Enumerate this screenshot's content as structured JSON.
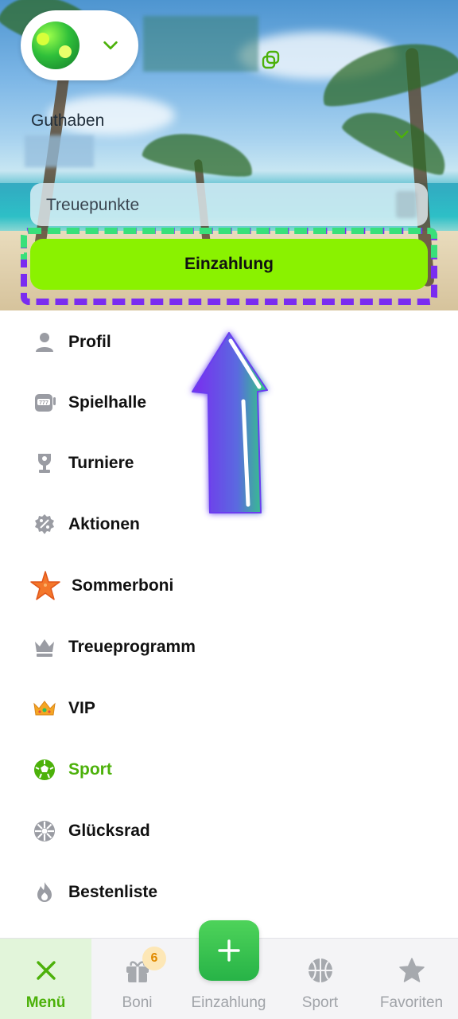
{
  "header": {
    "balance_label": "Guthaben",
    "loyalty_label": "Treuepunkte",
    "deposit_button": "Einzahlung"
  },
  "menu": {
    "items": [
      {
        "label": "Profil",
        "icon": "user-icon"
      },
      {
        "label": "Spielhalle",
        "icon": "slot-machine-icon"
      },
      {
        "label": "Turniere",
        "icon": "trophy-icon"
      },
      {
        "label": "Aktionen",
        "icon": "discount-badge-icon"
      },
      {
        "label": "Sommerboni",
        "icon": "starfish-icon"
      },
      {
        "label": "Treueprogramm",
        "icon": "crown-icon"
      },
      {
        "label": "VIP",
        "icon": "gold-crown-icon"
      },
      {
        "label": "Sport",
        "icon": "soccer-ball-icon"
      },
      {
        "label": "Glücksrad",
        "icon": "wheel-icon"
      },
      {
        "label": "Bestenliste",
        "icon": "flame-icon"
      }
    ],
    "active_item": "Sport"
  },
  "bottom_nav": {
    "menu": "Menü",
    "boni": "Boni",
    "boni_badge": "6",
    "deposit": "Einzahlung",
    "sport": "Sport",
    "favorites": "Favoriten"
  },
  "colors": {
    "accent_green": "#8af200",
    "active_green": "#4cb10a",
    "highlight_purple": "#7a2cf0",
    "highlight_teal": "#39e07a"
  }
}
